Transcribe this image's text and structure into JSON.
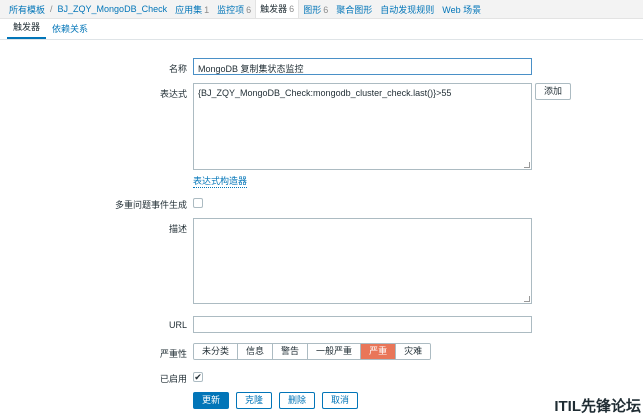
{
  "breadcrumb": {
    "items": [
      {
        "label": "所有模板",
        "count": ""
      },
      {
        "label": "BJ_ZQY_MongoDB_Check",
        "count": ""
      },
      {
        "label": "应用集",
        "count": "1"
      },
      {
        "label": "监控项",
        "count": "6"
      },
      {
        "label": "触发器",
        "count": "6"
      },
      {
        "label": "图形",
        "count": "6"
      },
      {
        "label": "聚合图形",
        "count": ""
      },
      {
        "label": "自动发现规则",
        "count": ""
      },
      {
        "label": "Web 场景",
        "count": ""
      }
    ]
  },
  "tabs": [
    {
      "label": "触发器"
    },
    {
      "label": "依赖关系"
    }
  ],
  "form": {
    "name_label": "名称",
    "name_value": "MongoDB 复制集状态监控",
    "expr_label": "表达式",
    "expr_value": "{BJ_ZQY_MongoDB_Check:mongodb_cluster_check.last()}>55",
    "add_button": "添加",
    "builder_link": "表达式构造器",
    "multi_label": "多重问题事件生成",
    "desc_label": "描述",
    "url_label": "URL",
    "severity_label": "严重性",
    "severities": [
      "未分类",
      "信息",
      "警告",
      "一般严重",
      "严重",
      "灾难"
    ],
    "selected_severity": "严重",
    "enabled_label": "已启用",
    "enabled_mark": "✔"
  },
  "actions": {
    "update": "更新",
    "clone": "克隆",
    "delete": "删除",
    "cancel": "取消"
  },
  "watermark": "ITIL先锋论坛",
  "colors": {
    "accent": "#0275b8",
    "severity_high": "#e97659"
  }
}
